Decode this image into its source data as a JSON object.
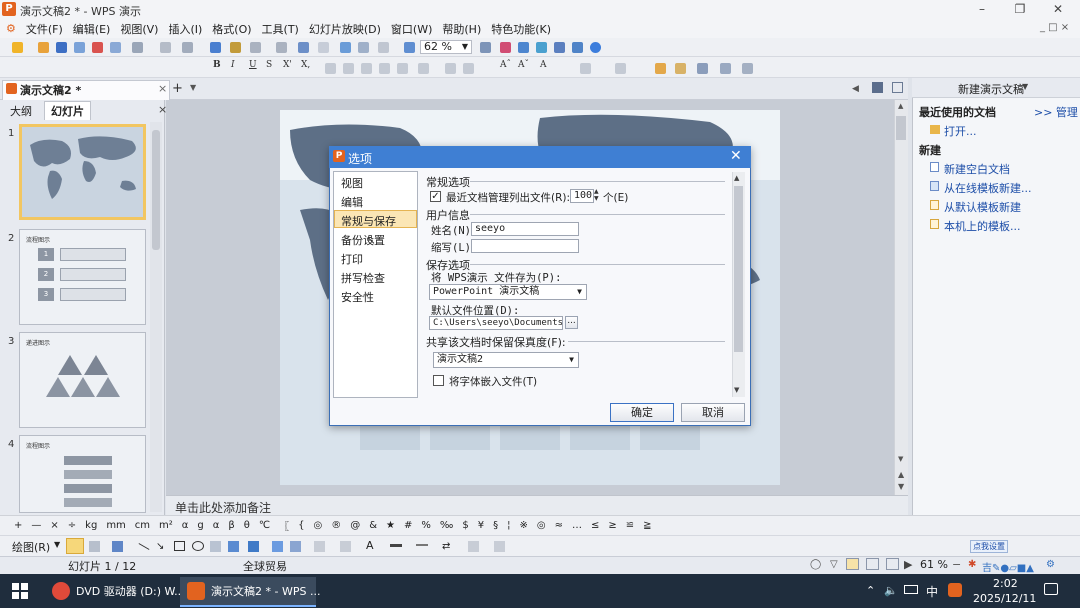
{
  "window": {
    "title": "演示文稿2 * - WPS 演示",
    "logo": "P"
  },
  "menu": [
    "文件(F)",
    "编辑(E)",
    "视图(V)",
    "插入(I)",
    "格式(O)",
    "工具(T)",
    "幻灯片放映(D)",
    "窗口(W)",
    "帮助(H)",
    "特色功能(K)"
  ],
  "toolbar": {
    "zoom": "62 %"
  },
  "doc_tab": {
    "label": "演示文稿2 *",
    "close": "×",
    "new_tab": "+"
  },
  "left_panel": {
    "tabs": [
      "大纲",
      "幻灯片"
    ],
    "slides": [
      {
        "num": "1",
        "title": ""
      },
      {
        "num": "2",
        "title": "流程图示",
        "items": [
          "1",
          "2",
          "3"
        ]
      },
      {
        "num": "3",
        "title": "递进图示"
      },
      {
        "num": "4",
        "title": "流程图示"
      }
    ]
  },
  "notes": {
    "placeholder": "单击此处添加备注"
  },
  "right_panel": {
    "title": "新建演示文稿",
    "recent_heading": "最近使用的文档",
    "manage": ">> 管理",
    "open": "打开...",
    "new_heading": "新建",
    "new_links": [
      "新建空白文档",
      "从在线模板新建...",
      "从默认模板新建",
      "本机上的模板..."
    ]
  },
  "symbols": [
    "+",
    "—",
    "×",
    "÷",
    "kg",
    "mm",
    "cm",
    "m²",
    "α",
    "g",
    "α",
    "β",
    "θ",
    "℃",
    "〖",
    "{",
    "◎",
    "®",
    "@",
    "&",
    "★",
    "#",
    "%",
    "‰",
    "$",
    "¥",
    "§",
    "¦",
    "※",
    "◎",
    "≈",
    "…",
    "≤",
    "≥",
    "≌",
    "≧"
  ],
  "draw": {
    "label": "绘图(R)"
  },
  "status": {
    "slide": "幻灯片 1 / 12",
    "theme": "全球贸易",
    "zoom": "61 %",
    "badge": "点我设置"
  },
  "taskbar": {
    "items": [
      {
        "label": "DVD 驱动器 (D:) W..."
      },
      {
        "label": "演示文稿2 * - WPS ..."
      }
    ],
    "ime": "中",
    "time": "2:02",
    "date": "2025/12/11"
  },
  "dialog": {
    "title": "选项",
    "close": "✕",
    "categories": [
      "视图",
      "编辑",
      "常规与保存",
      "备份设置",
      "打印",
      "拼写检查",
      "安全性"
    ],
    "selected_category": "常规与保存",
    "general": {
      "heading": "常规选项",
      "recent_label": "最近文档管理列出文件(R):",
      "recent_value": "100",
      "recent_unit": "个(E)",
      "recent_checked": "✓"
    },
    "user": {
      "heading": "用户信息",
      "name_label": "姓名(N):",
      "name_value": "seeyo",
      "initials_label": "缩写(L):",
      "initials_value": ""
    },
    "save": {
      "heading": "保存选项",
      "saveas_label": "将 WPS演示 文件存为(P):",
      "saveas_value": "PowerPoint 演示文稿",
      "location_label": "默认文件位置(D):",
      "location_value": "C:\\Users\\seeyo\\Documents",
      "browse": "..."
    },
    "fidelity": {
      "heading": "共享该文档时保留保真度(F):",
      "doc_value": "演示文稿2",
      "embed_label": "将字体嵌入文件(T)"
    },
    "ok": "确定",
    "cancel": "取消"
  }
}
